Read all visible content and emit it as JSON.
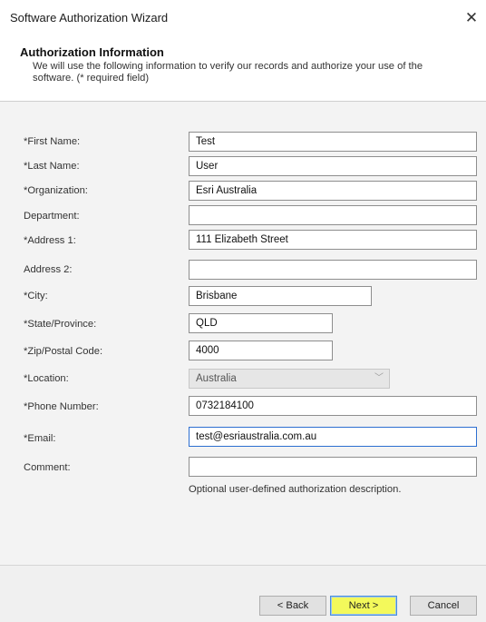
{
  "window": {
    "title": "Software Authorization Wizard",
    "close_glyph": "✕"
  },
  "header": {
    "title": "Authorization Information",
    "description": "We will use the following information to verify our records and authorize your use of the software. (* required field)"
  },
  "fields": {
    "first_name": {
      "label": "*First Name:",
      "value": "Test"
    },
    "last_name": {
      "label": "*Last Name:",
      "value": "User"
    },
    "organization": {
      "label": "*Organization:",
      "value": "Esri Australia"
    },
    "department": {
      "label": "Department:",
      "value": ""
    },
    "address1": {
      "label": "*Address 1:",
      "value": "111 Elizabeth Street"
    },
    "address2": {
      "label": "Address 2:",
      "value": ""
    },
    "city": {
      "label": "*City:",
      "value": "Brisbane"
    },
    "state": {
      "label": "*State/Province:",
      "value": "QLD"
    },
    "zip": {
      "label": "*Zip/Postal Code:",
      "value": "4000"
    },
    "location": {
      "label": "*Location:",
      "value": "Australia",
      "arrow": "﹀"
    },
    "phone": {
      "label": "*Phone Number:",
      "value": "0732184100"
    },
    "email": {
      "label": "*Email:",
      "value": "test@esriaustralia.com.au"
    },
    "comment": {
      "label": "Comment:",
      "value": "",
      "hint": "Optional user-defined authorization description."
    }
  },
  "buttons": {
    "back": "< Back",
    "next": "Next >",
    "cancel": "Cancel"
  },
  "colors": {
    "form_background": "#f3f3f3",
    "next_highlight": "#f3f95b",
    "focus_border": "#2d6fd1"
  }
}
